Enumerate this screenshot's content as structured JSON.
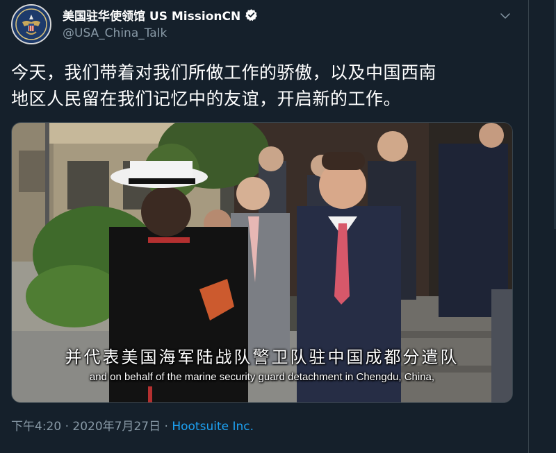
{
  "account": {
    "display_name": "美国驻华使领馆 US MissionCN",
    "handle": "@USA_China_Talk",
    "verified": true,
    "avatar_icon": "us-seal-avatar-icon"
  },
  "tweet": {
    "text_line1": "今天，我们带着对我们所做工作的骄傲，以及中国西南",
    "text_line2": "地区人民留在我们记忆中的友谊，开启新的工作。"
  },
  "media": {
    "subtitle_cn": "并代表美国海军陆战队警卫队驻中国成都分遣队",
    "subtitle_en": "and on behalf of the marine security guard detachment in Chengdu, China,"
  },
  "meta": {
    "time": "下午4:20",
    "separator": " · ",
    "date": "2020年7月27日",
    "separator2": " · ",
    "source": "Hootsuite Inc."
  },
  "colors": {
    "background": "#15202b",
    "secondary_text": "#8899a6",
    "link": "#1da1f2",
    "verified": "#ffffff"
  }
}
